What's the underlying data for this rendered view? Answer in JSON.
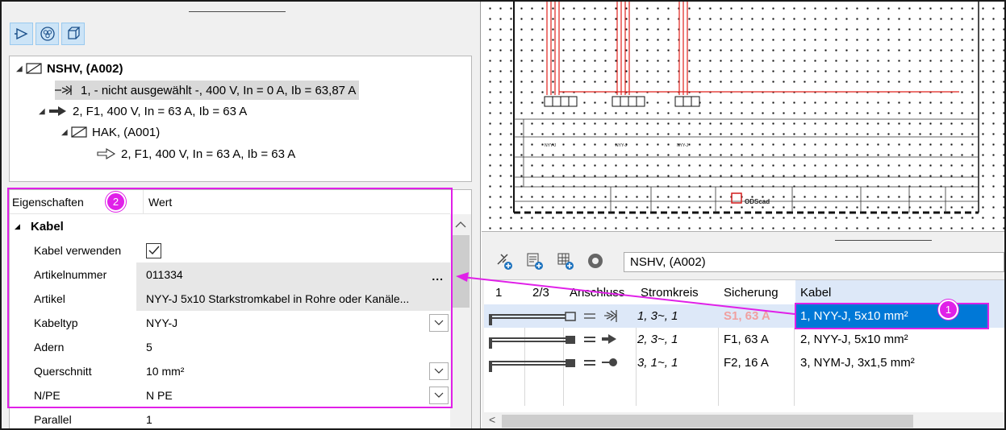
{
  "toolbar": {
    "icons": [
      "play-outline-icon",
      "circles-icon",
      "cube-icon"
    ]
  },
  "tree": {
    "nodes": [
      {
        "label": "NSHV,  (A002)",
        "bold": true
      },
      {
        "label": "1,  - nicht ausgewählt -, 400 V, In = 0 A, Ib = 63,87 A"
      },
      {
        "label": "2, F1, 400 V, In = 63 A, Ib = 63 A"
      },
      {
        "label": "HAK,  (A001)"
      },
      {
        "label": "2, F1, 400 V, In = 63 A, Ib = 63 A"
      }
    ]
  },
  "properties": {
    "header_key": "Eigenschaften",
    "header_value": "Wert",
    "badge": "2",
    "section": "Kabel",
    "rows": [
      {
        "key": "Kabel verwenden",
        "value": ""
      },
      {
        "key": "Artikelnummer",
        "value": "011334",
        "button": "..."
      },
      {
        "key": "Artikel",
        "value": "NYY-J 5x10 Starkstromkabel in Rohre oder Kanäle..."
      },
      {
        "key": "Kabeltyp",
        "value": "NYY-J"
      },
      {
        "key": "Adern",
        "value": "5"
      },
      {
        "key": "Querschnitt",
        "value": "10 mm²"
      },
      {
        "key": "N/PE",
        "value": "N PE"
      },
      {
        "key": "Parallel",
        "value": "1"
      }
    ]
  },
  "schematic": {
    "labels": [
      "NYY-J",
      "NYY-J",
      "NYY-J",
      "ODScad"
    ],
    "accent": "#e0201c"
  },
  "grid": {
    "address": "NSHV,  (A002)",
    "toolbar_icons": [
      "add-plug-icon",
      "add-list-icon",
      "add-table-icon",
      "settings-icon"
    ],
    "columns": [
      "1",
      "2/3",
      "Anschluss",
      "Stromkreis",
      "Sicherung",
      "Kabel"
    ],
    "rows": [
      {
        "stromkreis": "1, 3~, 1",
        "sicherung": "S1, 63 A",
        "kabel": "1, NYY-J, 5x10 mm²"
      },
      {
        "stromkreis": "2, 3~, 1",
        "sicherung": "F1, 63 A",
        "kabel": "2, NYY-J, 5x10 mm²"
      },
      {
        "stromkreis": "3, 1~, 1",
        "sicherung": "F2, 16 A",
        "kabel": "3, NYM-J, 3x1,5 mm²"
      }
    ],
    "badge": "1",
    "hscroll_left": "<"
  },
  "colors": {
    "selection": "#0078d7",
    "highlight": "#e020e8",
    "row_selected_bg": "#dde8f8",
    "fuse_red": "#f0a0a0"
  }
}
